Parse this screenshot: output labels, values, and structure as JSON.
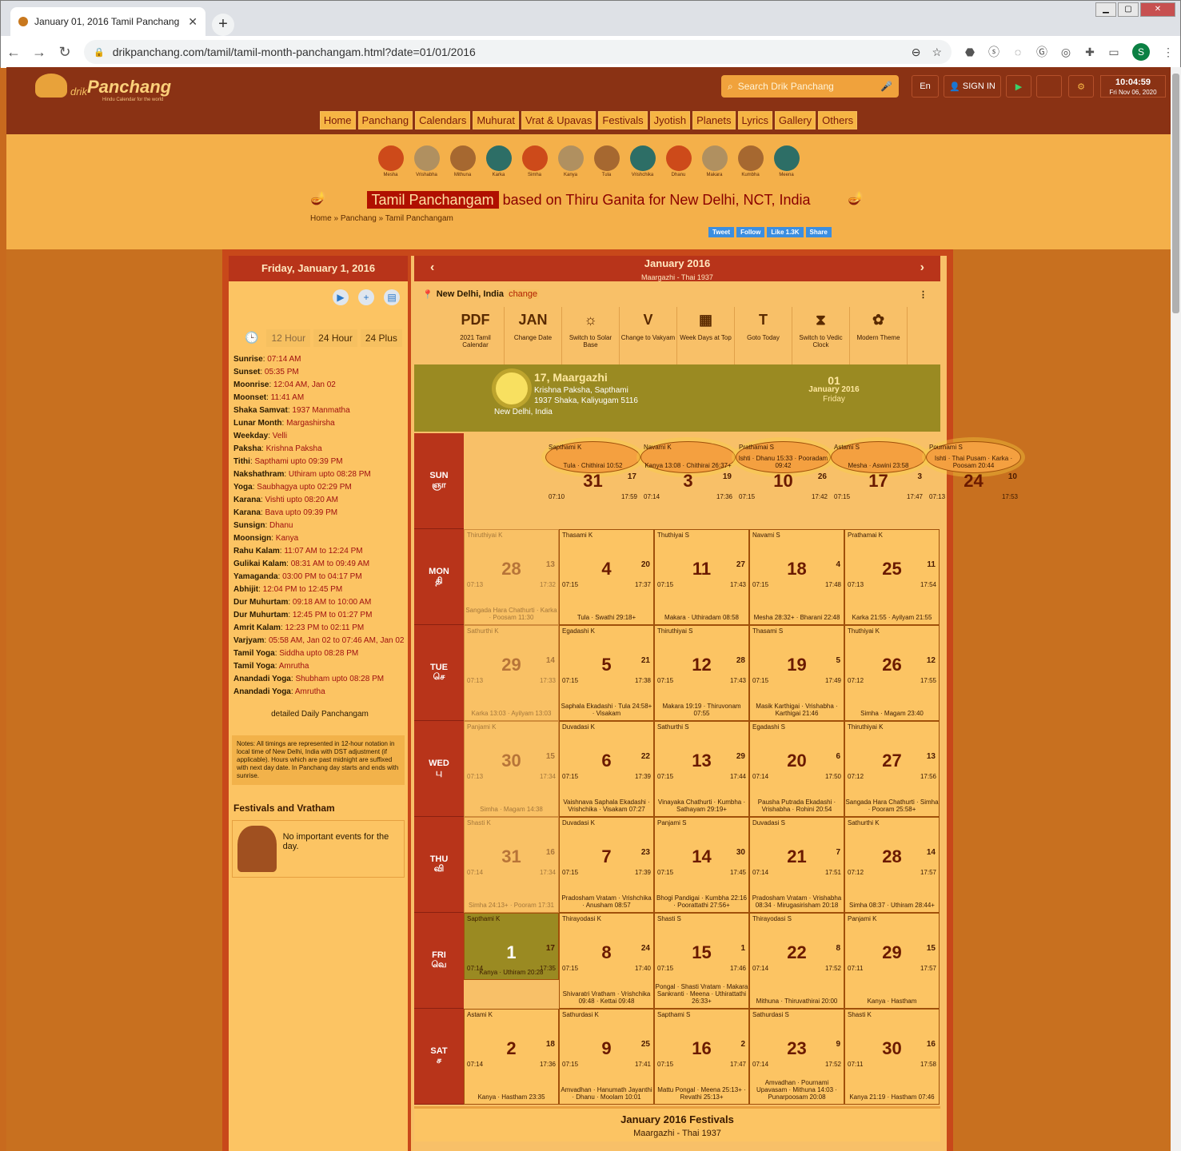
{
  "browser": {
    "tab_title": "January 01, 2016 Tamil Panchang",
    "url": "drikpanchang.com/tamil/tamil-month-panchangam.html?date=01/01/2016",
    "profile": "S"
  },
  "header": {
    "logo_prefix": "drik",
    "logo_name": "Panchang",
    "logo_tag": "Hindu Calendar for the world",
    "search_placeholder": "Search Drik Panchang",
    "lang": "En",
    "signin": "SIGN IN",
    "time": "10:04:59",
    "date": "Fri Nov 06, 2020"
  },
  "menu": [
    "Home",
    "Panchang",
    "Calendars",
    "Muhurat",
    "Vrat & Upavas",
    "Festivals",
    "Jyotish",
    "Planets",
    "Lyrics",
    "Gallery",
    "Others"
  ],
  "zodiac": [
    "Mesha",
    "Vrishabha",
    "Mithuna",
    "Karka",
    "Simha",
    "Kanya",
    "Tula",
    "Vrishchika",
    "Dhanu",
    "Makara",
    "Kumbha",
    "Meena"
  ],
  "banner": {
    "highlight": "Tamil Panchangam",
    "rest": "based on Thiru Ganita for New Delhi, NCT, India",
    "crumbs": [
      "Home",
      "Panchang",
      "Tamil Panchangam"
    ],
    "social": [
      "Tweet",
      "Follow",
      "Like 1.3K",
      "Share"
    ]
  },
  "left": {
    "title": "Friday, January 1, 2016",
    "hours": [
      "12 Hour",
      "24 Hour",
      "24 Plus"
    ],
    "rows": [
      [
        "Sunrise",
        "07:14 AM"
      ],
      [
        "Sunset",
        "05:35 PM"
      ],
      [
        "Moonrise",
        "12:04 AM, Jan 02"
      ],
      [
        "Moonset",
        "11:41 AM"
      ],
      [
        "Shaka Samvat",
        "1937 Manmatha"
      ],
      [
        "Lunar Month",
        "Margashirsha"
      ],
      [
        "Weekday",
        "Velli"
      ],
      [
        "Paksha",
        "Krishna Paksha"
      ],
      [
        "Tithi",
        "Sapthami upto 09:39 PM"
      ],
      [
        "Nakshathram",
        "Uthiram upto 08:28 PM"
      ],
      [
        "Yoga",
        "Saubhagya upto 02:29 PM"
      ],
      [
        "Karana",
        "Vishti upto 08:20 AM"
      ],
      [
        "Karana",
        "Bava upto 09:39 PM"
      ],
      [
        "Sunsign",
        "Dhanu"
      ],
      [
        "Moonsign",
        "Kanya"
      ],
      [
        "Rahu Kalam",
        "11:07 AM to 12:24 PM"
      ],
      [
        "Gulikai Kalam",
        "08:31 AM to 09:49 AM"
      ],
      [
        "Yamaganda",
        "03:00 PM to 04:17 PM"
      ],
      [
        "Abhijit",
        "12:04 PM to 12:45 PM"
      ],
      [
        "Dur Muhurtam",
        "09:18 AM to 10:00 AM"
      ],
      [
        "Dur Muhurtam",
        "12:45 PM to 01:27 PM"
      ],
      [
        "Amrit Kalam",
        "12:23 PM to 02:11 PM"
      ],
      [
        "Varjyam",
        "05:58 AM, Jan 02 to 07:46 AM, Jan 02"
      ],
      [
        "Tamil Yoga",
        "Siddha upto 08:28 PM"
      ],
      [
        "Tamil Yoga",
        "Amrutha"
      ],
      [
        "Anandadi Yoga",
        "Shubham upto 08:28 PM"
      ],
      [
        "Anandadi Yoga",
        "Amrutha"
      ]
    ],
    "detail_link": "detailed Daily Panchangam",
    "notes": "Notes: All timings are represented in 12-hour notation in local time of New Delhi, India with DST adjustment (if applicable). Hours which are past midnight are suffixed with next day date. In Panchang day starts and ends with sunrise.",
    "fest_title": "Festivals and Vratham",
    "fest_msg": "No important events for the day."
  },
  "cal": {
    "month": "January 2016",
    "sub": "Maargazhi - Thai 1937",
    "location": "New Delhi, India",
    "change": "change",
    "tools": [
      [
        "PDF",
        "2021 Tamil Calendar"
      ],
      [
        "JAN",
        "Change Date"
      ],
      [
        "☼",
        "Switch to Solar Base"
      ],
      [
        "V",
        "Change to Vakyam"
      ],
      [
        "▦",
        "Week Days at Top"
      ],
      [
        "T",
        "Goto Today"
      ],
      [
        "⧗",
        "Switch to Vedic Clock"
      ],
      [
        "✿",
        "Modern Theme"
      ]
    ],
    "today": {
      "title": "17, Maargazhi",
      "l1": "Krishna Paksha, Sapthami",
      "l2": "1937 Shaka, Kaliyugam 5116",
      "loc": "New Delhi, India",
      "day": "01",
      "month": "January 2016",
      "weekday": "Friday"
    },
    "weekdays": [
      [
        "SUN",
        "ஞா"
      ],
      [
        "MON",
        "தி"
      ],
      [
        "TUE",
        "செ"
      ],
      [
        "WED",
        "பு"
      ],
      [
        "THU",
        "வி"
      ],
      [
        "FRI",
        "வெ"
      ],
      [
        "SAT",
        "ச"
      ]
    ],
    "rows": [
      [
        [
          "Sapthami K",
          "31",
          "17",
          "07:10",
          "17:59",
          "Tula · Chithirai 10:52"
        ],
        [
          "Navami K",
          "3",
          "19",
          "07:14",
          "17:36",
          "Kanya 13:08 · Chithirai 26:37+"
        ],
        [
          "Prathamai S",
          "10",
          "26",
          "07:15",
          "17:42",
          "Ishti · Dhanu 15:33 · Pooradam 09:42"
        ],
        [
          "Astami S",
          "17",
          "3",
          "07:15",
          "17:47",
          "Mesha · Aswini 23:58"
        ],
        [
          "Pournami S",
          "24",
          "10",
          "07:13",
          "17:53",
          "Ishti · Thai Pusam · Karka · Poosam 20:44"
        ]
      ],
      [
        [
          "Thiruthiyai K",
          "28",
          "13",
          "07:13",
          "17:32",
          "Sangada Hara Chathurti · Karka · Poosam 11:30"
        ],
        [
          "Thasami K",
          "4",
          "20",
          "07:15",
          "17:37",
          "Tula · Swathi 29:18+"
        ],
        [
          "Thuthiyai S",
          "11",
          "27",
          "07:15",
          "17:43",
          "Makara · Uthiradam 08:58"
        ],
        [
          "Navami S",
          "18",
          "4",
          "07:15",
          "17:48",
          "Mesha 28:32+ · Bharani 22:48"
        ],
        [
          "Prathamai K",
          "25",
          "11",
          "07:13",
          "17:54",
          "Karka 21:55 · Ayilyam 21:55"
        ]
      ],
      [
        [
          "Sathurthi K",
          "29",
          "14",
          "07:13",
          "17:33",
          "Karka 13:03 · Ayilyam 13:03"
        ],
        [
          "Egadashi K",
          "5",
          "21",
          "07:15",
          "17:38",
          "Saphala Ekadashi · Tula 24:58+ · Visakam"
        ],
        [
          "Thiruthiyai S",
          "12",
          "28",
          "07:15",
          "17:43",
          "Makara 19:19 · Thiruvonam 07:55"
        ],
        [
          "Thasami S",
          "19",
          "5",
          "07:15",
          "17:49",
          "Masik Karthigai · Vrishabha · Karthigai 21:46"
        ],
        [
          "Thuthiyai K",
          "26",
          "12",
          "07:12",
          "17:55",
          "Simha · Magam 23:40"
        ]
      ],
      [
        [
          "Panjami K",
          "30",
          "15",
          "07:13",
          "17:34",
          "Simha · Magam 14:38"
        ],
        [
          "Duvadasi K",
          "6",
          "22",
          "07:15",
          "17:39",
          "Vaishnava Saphala Ekadashi · Vrishchika · Visakam 07:27"
        ],
        [
          "Sathurthi S",
          "13",
          "29",
          "07:15",
          "17:44",
          "Vinayaka Chathurti · Kumbha · Sathayam 29:19+"
        ],
        [
          "Egadashi S",
          "20",
          "6",
          "07:14",
          "17:50",
          "Pausha Putrada Ekadashi · Vrishabha · Rohini 20:54"
        ],
        [
          "Thiruthiyai K",
          "27",
          "13",
          "07:12",
          "17:56",
          "Sangada Hara Chathurti · Simha · Pooram 25:58+"
        ]
      ],
      [
        [
          "Shasti K",
          "31",
          "16",
          "07:14",
          "17:34",
          "Simha 24:13+ · Pooram 17:31"
        ],
        [
          "Duvadasi K",
          "7",
          "23",
          "07:15",
          "17:39",
          "Pradosham Vratam · Vrishchika · Anusham 08:57"
        ],
        [
          "Panjami S",
          "14",
          "30",
          "07:15",
          "17:45",
          "Bhogi Pandigai · Kumbha 22:16 · Poorattathi 27:56+"
        ],
        [
          "Duvadasi S",
          "21",
          "7",
          "07:14",
          "17:51",
          "Pradosham Vratam · Vrishabha 08:34 · Mirugasirisham 20:18"
        ],
        [
          "Sathurthi K",
          "28",
          "14",
          "07:12",
          "17:57",
          "Simha 08:37 · Uthiram 28:44+"
        ]
      ],
      [
        [
          "Sapthami K",
          "1",
          "17",
          "07:14",
          "17:35",
          "Kanya · Uthiram 20:28"
        ],
        [
          "Thirayodasi K",
          "8",
          "24",
          "07:15",
          "17:40",
          "Shivaratri Vratham · Vrishchika 09:48 · Kettai 09:48"
        ],
        [
          "Shasti S",
          "15",
          "1",
          "07:15",
          "17:46",
          "Pongal · Shasti Vratam · Makara Sankranti · Meena · Uthirattathi 26:33+"
        ],
        [
          "Thirayodasi S",
          "22",
          "8",
          "07:14",
          "17:52",
          "Mithuna · Thiruvathirai 20:00"
        ],
        [
          "Panjami K",
          "29",
          "15",
          "07:11",
          "17:57",
          "Kanya · Hastham"
        ]
      ],
      [
        [
          "Astami K",
          "2",
          "18",
          "07:14",
          "17:36",
          "Kanya · Hastham 23:35"
        ],
        [
          "Sathurdasi K",
          "9",
          "25",
          "07:15",
          "17:41",
          "Amvadhan · Hanumath Jayanthi · Dhanu · Moolam 10:01"
        ],
        [
          "Sapthami S",
          "16",
          "2",
          "07:15",
          "17:47",
          "Mattu Pongal · Meena 25:13+ · Revathi 25:13+"
        ],
        [
          "Sathurdasi S",
          "23",
          "9",
          "07:14",
          "17:52",
          "Amvadhan · Pournami Upavasam · Mithuna 14:03 · Punarpoosam 20:08"
        ],
        [
          "Shasti K",
          "30",
          "16",
          "07:11",
          "17:58",
          "Kanya 21:19 · Hastham 07:46"
        ]
      ]
    ],
    "fest_title": "January 2016 Festivals",
    "fest_sub": "Maargazhi - Thai 1937"
  }
}
